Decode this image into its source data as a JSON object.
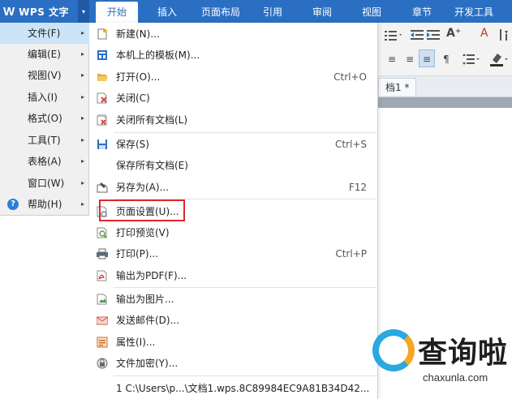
{
  "app": {
    "logo": "W",
    "title": "WPS 文字",
    "dropdown_arrow": "▾"
  },
  "ribbon": {
    "tabs": [
      "开始",
      "插入",
      "页面布局",
      "引用",
      "审阅",
      "视图",
      "章节",
      "开发工具"
    ],
    "active_tab": "开始",
    "tools": [
      "A⁺",
      "A",
      "≡",
      "≡",
      "≡",
      "¶"
    ]
  },
  "document": {
    "tab_label": "档1 *"
  },
  "main_menu": {
    "items": [
      {
        "label": "文件(F)",
        "arrow": "▸"
      },
      {
        "label": "编辑(E)",
        "arrow": "▸"
      },
      {
        "label": "视图(V)",
        "arrow": "▸"
      },
      {
        "label": "插入(I)",
        "arrow": "▸"
      },
      {
        "label": "格式(O)",
        "arrow": "▸"
      },
      {
        "label": "工具(T)",
        "arrow": "▸"
      },
      {
        "label": "表格(A)",
        "arrow": "▸"
      },
      {
        "label": "窗口(W)",
        "arrow": "▸"
      },
      {
        "label": "帮助(H)",
        "arrow": "▸"
      }
    ],
    "help_glyph": "?"
  },
  "file_submenu": {
    "items": [
      {
        "label": "新建(N)...",
        "shortcut": "",
        "icon": "new-document-icon",
        "color": "#f2f2f2"
      },
      {
        "label": "本机上的模板(M)...",
        "shortcut": "",
        "icon": "template-icon",
        "color": "#2d6fc0"
      },
      {
        "label": "打开(O)...",
        "shortcut": "Ctrl+O",
        "icon": "open-folder-icon",
        "color": "#e8a93a"
      },
      {
        "label": "关闭(C)",
        "shortcut": "",
        "icon": "close-document-icon",
        "color": "#d8473c"
      },
      {
        "label": "关闭所有文档(L)",
        "shortcut": "",
        "icon": "close-all-icon",
        "color": "#d8473c"
      },
      {
        "label": "保存(S)",
        "shortcut": "Ctrl+S",
        "icon": "save-icon",
        "color": "#2d6fc0"
      },
      {
        "label": "保存所有文档(E)",
        "shortcut": "",
        "icon": "",
        "color": ""
      },
      {
        "label": "另存为(A)...",
        "shortcut": "F12",
        "icon": "save-as-icon",
        "color": "#4a4a4a"
      },
      {
        "label": "页面设置(U)...",
        "shortcut": "",
        "icon": "page-setup-icon",
        "color": "#8c8c8c"
      },
      {
        "label": "打印预览(V)",
        "shortcut": "",
        "icon": "print-preview-icon",
        "color": "#6a9a4e"
      },
      {
        "label": "打印(P)...",
        "shortcut": "Ctrl+P",
        "icon": "print-icon",
        "color": "#5a6a80"
      },
      {
        "label": "输出为PDF(F)...",
        "shortcut": "",
        "icon": "pdf-icon",
        "color": "#c0392b"
      },
      {
        "label": "输出为图片...",
        "shortcut": "",
        "icon": "image-export-icon",
        "color": "#4a9a5a"
      },
      {
        "label": "发送邮件(D)...",
        "shortcut": "",
        "icon": "email-icon",
        "color": "#d85a4a"
      },
      {
        "label": "属性(I)...",
        "shortcut": "",
        "icon": "properties-icon",
        "color": "#c96a2a"
      },
      {
        "label": "文件加密(Y)...",
        "shortcut": "",
        "icon": "encrypt-icon",
        "color": "#6a6a6a"
      },
      {
        "label": "1 C:\\Users\\p...\\文档1.wps.8C89984EC9A81B34D42...",
        "shortcut": "",
        "icon": "",
        "color": ""
      }
    ]
  },
  "watermark": {
    "text": "查询啦",
    "url": "chaxunla.com",
    "colors": {
      "blue": "#2aa8e0",
      "orange": "#f6a623"
    }
  }
}
